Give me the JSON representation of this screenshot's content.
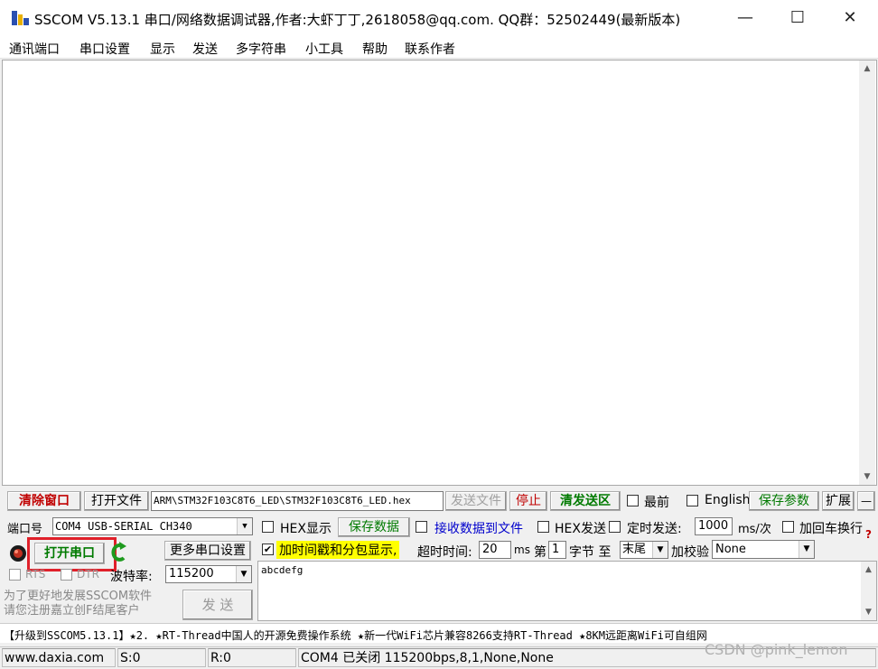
{
  "window": {
    "title": "SSCOM V5.13.1 串口/网络数据调试器,作者:大虾丁丁,2618058@qq.com. QQ群：52502449(最新版本)",
    "min_glyph": "—",
    "max_glyph": "☐",
    "close_glyph": "✕"
  },
  "menu": [
    "通讯端口",
    "串口设置",
    "显示",
    "发送",
    "多字符串",
    "小工具",
    "帮助",
    "联系作者"
  ],
  "toolbar": {
    "clear_window": "清除窗口",
    "open_file": "打开文件",
    "file_path": "ARM\\STM32F103C8T6_LED\\STM32F103C8T6_LED.hex",
    "send_file": "发送文件",
    "stop": "停止",
    "clear_send": "清发送区",
    "topmost": "最前",
    "english": "English",
    "save_params": "保存参数",
    "expand": "扩展",
    "minus": "—"
  },
  "port": {
    "port_label": "端口号",
    "port_value": "COM4 USB-SERIAL CH340",
    "open_port": "打开串口",
    "more_settings": "更多串口设置",
    "rts": "RTS",
    "dtr": "DTR",
    "baud_label": "波特率:",
    "baud_value": "115200"
  },
  "options": {
    "hex_display": "HEX显示",
    "save_data": "保存数据",
    "recv_to_file": "接收数据到文件",
    "hex_send": "HEX发送",
    "timed_send": "定时发送:",
    "interval_value": "1000",
    "interval_unit": "ms/次",
    "add_crlf": "加回车换行",
    "timestamp": "加时间戳和分包显示,",
    "timeout_label": "超时时间:",
    "timeout_value": "20",
    "timeout_unit": "ms",
    "byte_prefix": "第",
    "byte_value": "1",
    "byte_suffix": "字节 至",
    "byte_end": "末尾",
    "checksum_label": "加校验",
    "checksum_value": "None"
  },
  "send": {
    "text": "abcdefg",
    "button": "发  送",
    "promo": "为了更好地发展SSCOM软件\n请您注册嘉立创F结尾客户"
  },
  "marquee": "【升级到SSCOM5.13.1】★2. ★RT-Thread中国人的开源免费操作系统 ★新一代WiFi芯片兼容8266支持RT-Thread ★8KM远距离WiFi可自组网",
  "status": {
    "site": "www.daxia.com",
    "sent": "S:0",
    "received": "R:0",
    "port_state": "COM4 已关闭  115200bps,8,1,None,None"
  },
  "watermark": "CSDN @pink_lemon",
  "colors": {
    "highlight_box": "#e0202a",
    "clear_red": "#c00000",
    "green_text": "#007a00",
    "blue_text": "#0000cc",
    "timestamp_bg": "#ffff00"
  }
}
